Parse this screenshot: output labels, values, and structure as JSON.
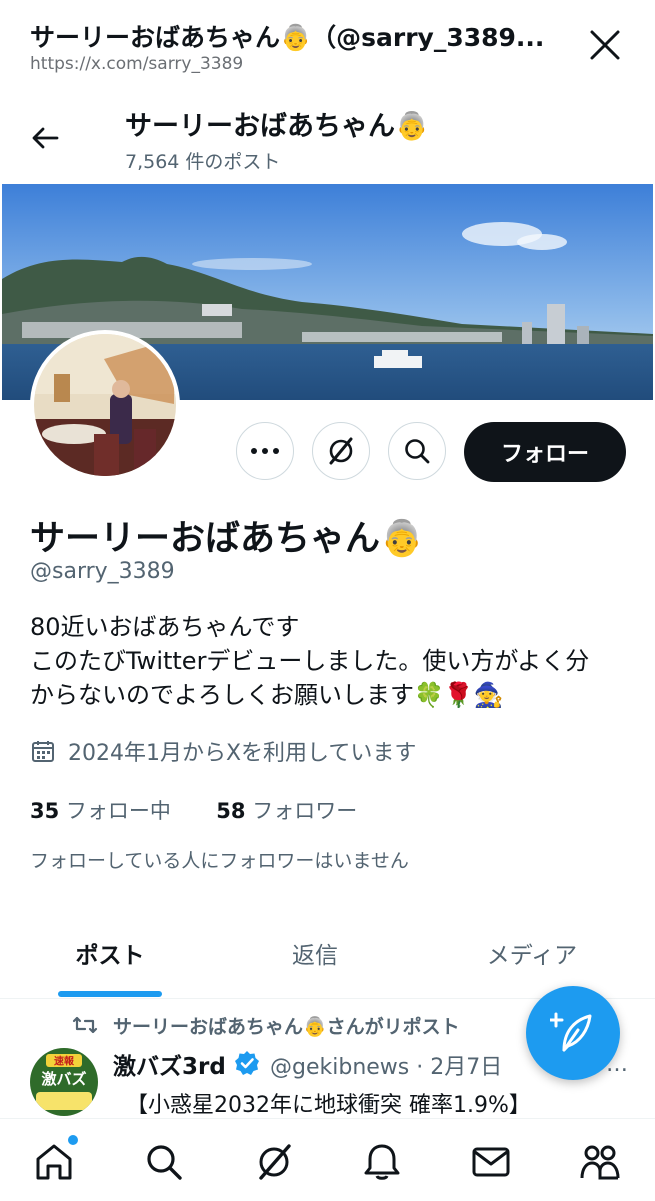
{
  "browser": {
    "title": "サーリーおばあちゃん👵（@sarry_3389...",
    "url": "https://x.com/sarry_3389"
  },
  "header": {
    "name": "サーリーおばあちゃん",
    "name_emoji": "👵",
    "post_count": "7,564 件のポスト"
  },
  "profile": {
    "display_name": "サーリーおばあちゃん",
    "display_emoji": "👵",
    "handle": "@sarry_3389",
    "bio_lines": [
      "80近いおばあちゃんです",
      "このたびTwitterデビューしました。使い方がよく分",
      "からないのでよろしくお願いします🍀🌹🧙"
    ],
    "joined": "2024年1月からXを利用しています",
    "following_count": "35",
    "following_label": "フォロー中",
    "followers_count": "58",
    "followers_label": "フォロワー",
    "mutual_note": "フォローしている人にフォロワーはいません",
    "follow_label": "フォロー"
  },
  "tabs": [
    "ポスト",
    "返信",
    "メディア"
  ],
  "tweet": {
    "repost_line": "サーリーおばあちゃん👵さんがリポスト",
    "author_name": "激バズ3rd",
    "author_meta": "@gekibnews · 2月7日",
    "avatar_badge": "速報",
    "avatar_title": "激バズ",
    "text": "【小惑星2032年に地球衝突 確率1.9%】",
    "more": "…"
  },
  "icons": {
    "close": "close-icon",
    "back": "back-arrow-icon",
    "more": "more-icon",
    "grok": "grok-icon",
    "search": "search-icon",
    "calendar": "calendar-icon",
    "repost": "repost-icon",
    "verified": "verified-badge-icon",
    "compose": "compose-icon",
    "nav": [
      "home-icon",
      "search-icon",
      "grok-icon",
      "notifications-icon",
      "messages-icon",
      "communities-icon"
    ]
  },
  "colors": {
    "accent": "#1d9bf0",
    "text": "#0f1419",
    "secondary": "#536471",
    "follow_bg": "#0f1419"
  }
}
